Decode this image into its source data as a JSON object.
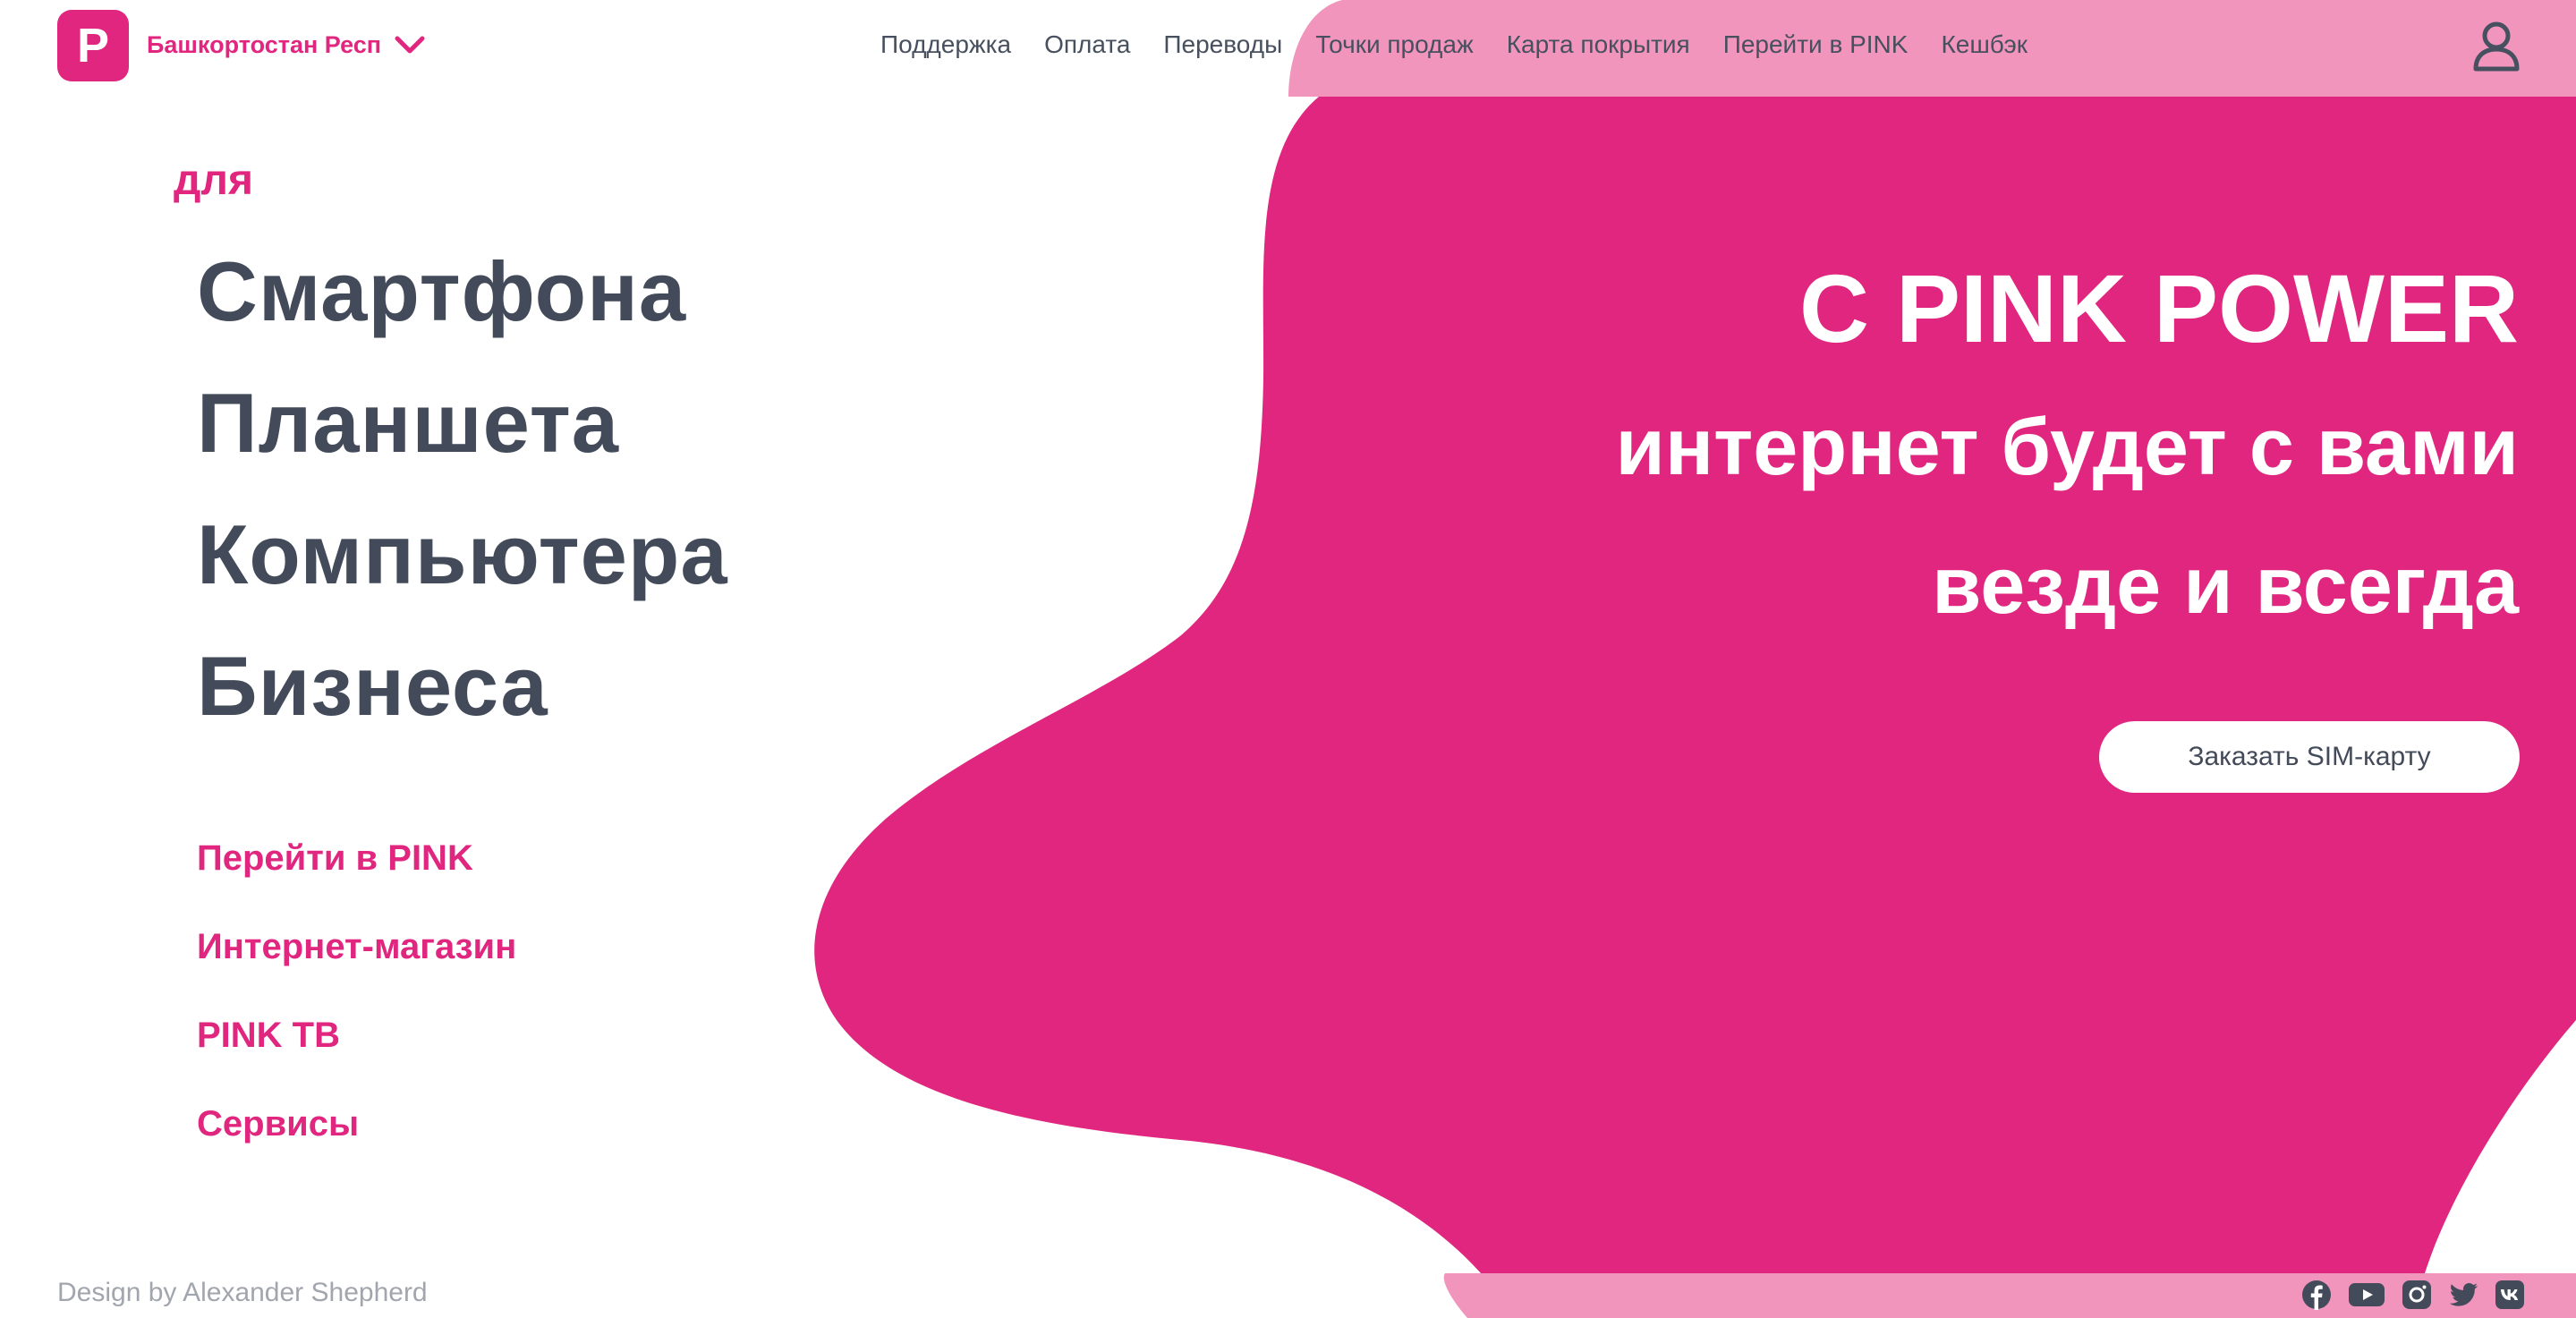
{
  "header": {
    "logo_letter": "P",
    "region": "Башкортостан Респ",
    "nav": [
      "Поддержка",
      "Оплата",
      "Переводы",
      "Точки продаж",
      "Карта покрытия",
      "Перейти в PINK",
      "Кешбэк"
    ],
    "icons": {
      "chevron": "chevron-down-icon",
      "user": "user-icon"
    }
  },
  "left": {
    "for_label": "для",
    "targets": [
      "Смартфона",
      "Планшета",
      "Компьютера",
      "Бизнеса"
    ],
    "links": [
      "Перейти в PINK",
      "Интернет-магазин",
      "PINK ТВ",
      "Сервисы"
    ]
  },
  "hero": {
    "line1": "С PINK POWER",
    "line2": "интернет будет с вами",
    "line3": "везде и всегда",
    "cta": "Заказать SIM-карту"
  },
  "footer": {
    "credit": "Design by Alexander Shepherd",
    "socials": [
      "facebook-icon",
      "youtube-icon",
      "instagram-icon",
      "twitter-icon",
      "vk-icon"
    ]
  },
  "colors": {
    "accent": "#e0267e",
    "light_pink": "#f195bd",
    "text_dark": "#434b5a",
    "text_muted": "#a1a6ae"
  }
}
